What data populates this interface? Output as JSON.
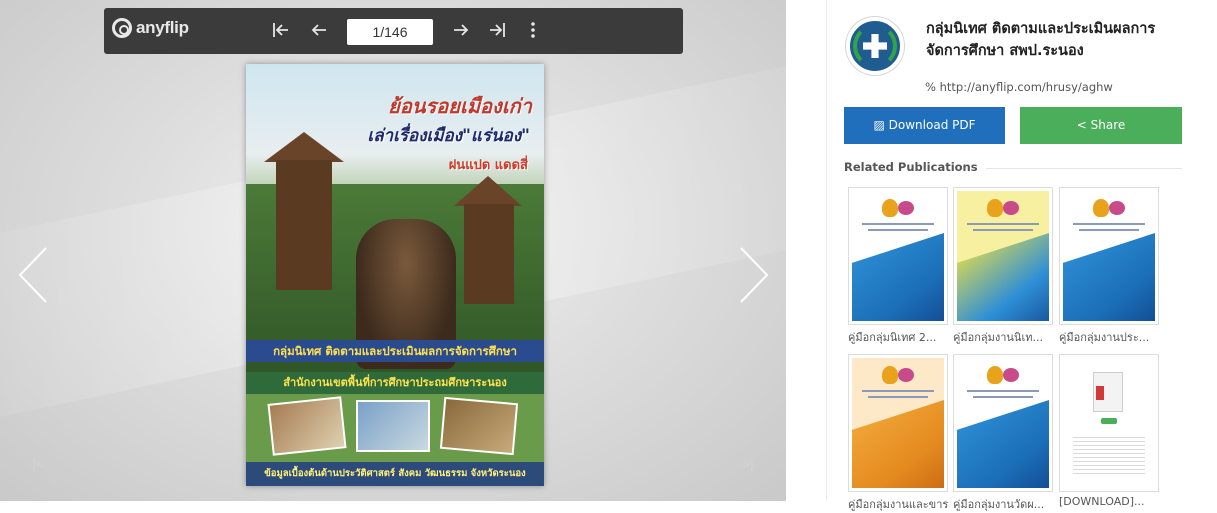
{
  "viewer": {
    "brand": "anyflip",
    "page_indicator": "1/146",
    "toolbar": {
      "first_icon": "first-page-icon",
      "prev_icon": "prev-page-icon",
      "next_icon": "next-page-icon",
      "last_icon": "last-page-icon",
      "more_icon": "more-vertical-icon"
    },
    "cover": {
      "title_line1": "ย้อนรอยเมืองเก่า",
      "title_line2": "เล่าเรื่องเมือง\"แร่นอง\"",
      "title_line3": "ฝนแปด แดดสี่",
      "band1": "กลุ่มนิเทศ ติดตามและประเมินผลการจัดการศึกษา",
      "band2": "สำนักงานเขตพื้นที่การศึกษาประถมศึกษาระนอง",
      "footer": "ข้อมูลเบื้องต้นด้านประวัติศาสตร์ สังคม วัฒนธรรม จังหวัดระนอง"
    }
  },
  "publisher": {
    "name": "กลุ่มนิเทศ ติดตามและประเมินผลการจัดการศึกษา สพป.ระนอง",
    "link": "http://anyflip.com/hrusy/aghw",
    "download_label": "Download PDF",
    "share_label": "Share"
  },
  "related": {
    "title": "Related Publications",
    "items": [
      {
        "caption": "คู่มือกลุ่มนิเทศ 2...",
        "style": "blue"
      },
      {
        "caption": "คู่มือกลุ่มงานนิเท...",
        "style": "yellow"
      },
      {
        "caption": "คู่มือกลุ่มงานประ...",
        "style": "blue"
      },
      {
        "caption": "คู่มือกลุ่มงานและขาร",
        "style": "orange"
      },
      {
        "caption": "คู่มือกลุ่มงานวัดผ...",
        "style": "blue"
      },
      {
        "caption": "[DOWNLOAD]...",
        "style": "doc"
      }
    ]
  },
  "colors": {
    "download": "#1f6fbd",
    "share": "#4bae5a",
    "toolbar": "#3b3b3b"
  }
}
